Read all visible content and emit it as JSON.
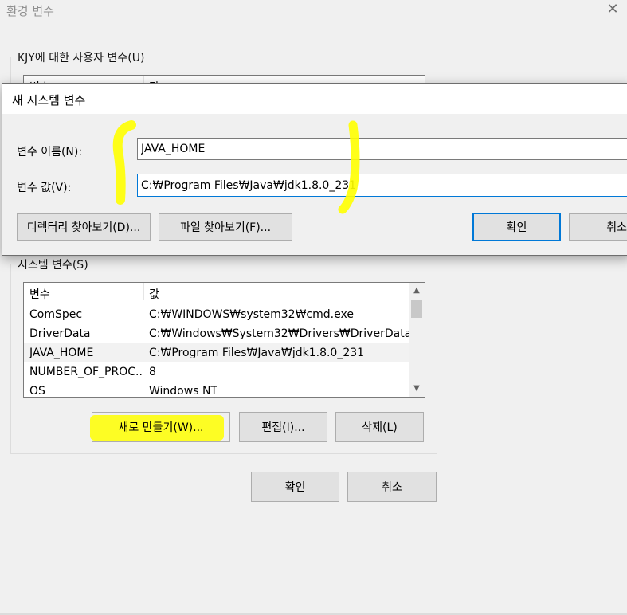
{
  "background_window": {
    "title": "환경 변수",
    "close_glyph": "✕",
    "user_group_label": "KJY에 대한 사용자 변수(U)",
    "user_list_header": {
      "name": "변수",
      "value": "값"
    },
    "system_group_label": "시스템 변수(S)",
    "system_list_header": {
      "name": "변수",
      "value": "값"
    },
    "system_rows": [
      {
        "name": "ComSpec",
        "value": "C:₩WINDOWS₩system32₩cmd.exe"
      },
      {
        "name": "DriverData",
        "value": "C:₩Windows₩System32₩Drivers₩DriverData"
      },
      {
        "name": "JAVA_HOME",
        "value": "C:₩Program Files₩Java₩jdk1.8.0_231"
      },
      {
        "name": "NUMBER_OF_PROC...",
        "value": "8"
      },
      {
        "name": "OS",
        "value": "Windows NT"
      }
    ],
    "system_buttons": {
      "new": "새로 만들기(W)...",
      "edit": "편집(I)...",
      "delete": "삭제(L)"
    },
    "footer_buttons": {
      "ok": "확인",
      "cancel": "취소"
    }
  },
  "new_system_variable_dialog": {
    "title": "새 시스템 변수",
    "name_label": "변수 이름(N):",
    "name_value": "JAVA_HOME",
    "value_label": "변수 값(V):",
    "value_value": "C:₩Program Files₩Java₩jdk1.8.0_231",
    "browse_directory_label": "디렉터리 찾아보기(D)...",
    "browse_file_label": "파일 찾아보기(F)...",
    "ok_label": "확인",
    "cancel_label": "취소"
  },
  "colors": {
    "focus_blue": "#0078d7",
    "highlight_yellow": "#ffff00",
    "window_bg": "#f0f0f0"
  }
}
